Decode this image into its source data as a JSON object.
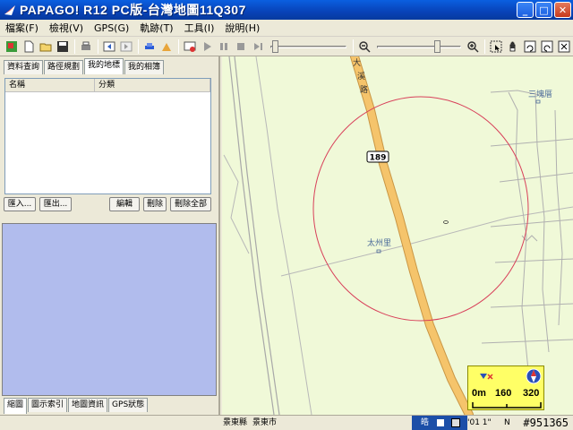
{
  "window": {
    "title": "PAPAGO!  R12  PC版-台灣地圖11Q307",
    "minimize": "_",
    "maximize": "□",
    "close": "✕"
  },
  "menu": [
    {
      "label": "檔案(F)"
    },
    {
      "label": "檢視(V)"
    },
    {
      "label": "GPS(G)"
    },
    {
      "label": "軌跡(T)"
    },
    {
      "label": "工具(I)"
    },
    {
      "label": "說明(H)"
    }
  ],
  "left_panel": {
    "tabs": [
      "資料查詢",
      "路徑規劃",
      "我的地標",
      "我的相簿"
    ],
    "active_tab": "我的地標",
    "columns": [
      "名稱",
      "分類"
    ],
    "buttons": [
      "匯入...",
      "匯出...",
      "編輯",
      "刪除",
      "刪除全部"
    ],
    "bottom_tabs": [
      "縮圖",
      "圖示索引",
      "地圖資訊",
      "GPS狀態"
    ]
  },
  "map": {
    "road_name": "大溪路",
    "road_chars": [
      "大",
      "溪",
      "路"
    ],
    "route_shield": "189",
    "place_label": "太州里",
    "village_label": "三塊厝"
  },
  "scale": {
    "labels": [
      "0m",
      "160",
      "320"
    ]
  },
  "status": {
    "item1": "景東縣",
    "item2": "景東市",
    "coord": "'01 1\"",
    "direction": "N",
    "watermark": "#951365"
  },
  "colors": {
    "map_background": "#f0f9d8",
    "road": "#f5c46b",
    "circle": "#d8405a",
    "preview": "#b1bced",
    "scale_widget": "#ffff66"
  }
}
